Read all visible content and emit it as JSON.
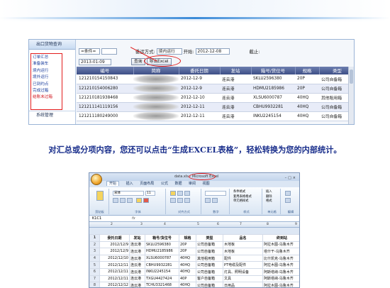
{
  "top_app": {
    "sidebar": {
      "header": "出口货物查询",
      "items": [
        "订单汇总",
        "准备装车",
        "境内运行",
        "境外运行",
        "已到约点",
        "完成过箱",
        "结账未过箱"
      ],
      "footer": "系统管理"
    },
    "filters": {
      "condition_select": "=条件=",
      "transport_label": "委运方式:",
      "transport_select": "境内运行",
      "start_label": "开始:",
      "start_value": "2012-12-08",
      "end_label": "截止:",
      "end_value": "2013-01-09",
      "query_button": "查询",
      "export_button": "导出Excel"
    },
    "table": {
      "columns": [
        "编号",
        "简称",
        "委托日期",
        "发站",
        "箱号/货位号",
        "规格",
        "类型"
      ],
      "rows": [
        [
          "121210154150843",
          "",
          "2012-12-9",
          "连云港",
          "SKLU2596380",
          "20P",
          "公司自备箱"
        ],
        [
          "121210154006280",
          "",
          "2012-12-9",
          "连云港",
          "HDMU2185986",
          "20P",
          "公司自备箱"
        ],
        [
          "121210181938468",
          "",
          "2012-12-10",
          "连云港",
          "XLSU6000787",
          "40HQ",
          "其他租用箱"
        ],
        [
          "121211141119156",
          "",
          "2012-12-11",
          "连云港",
          "CBHU9932281",
          "40HQ",
          "公司自备箱"
        ],
        [
          "121211180249000",
          "",
          "2012-12-11",
          "连云港",
          "INKU2245154",
          "40HQ",
          "公司自备箱"
        ]
      ]
    }
  },
  "caption": "对汇总或分项内容，您还可以点击“生成EXCEL表格”，轻松转换为您的内部统计。",
  "excel": {
    "title": "data.xls - Microsoft Excel",
    "tabs": [
      "开始",
      "插入",
      "页面布局",
      "公式",
      "数据",
      "审阅",
      "视图"
    ],
    "ribbon": {
      "font_name": "宋体",
      "font_size": "11",
      "groups": [
        "剪贴板",
        "字体",
        "对齐方式",
        "数字",
        "样式",
        "单元格",
        "编辑"
      ],
      "styles": [
        "条件格式",
        "套用表格格式",
        "单元格样式"
      ],
      "cells": [
        "插入",
        "删除",
        "格式"
      ]
    },
    "cell_ref": "K1C1",
    "col_numbers": [
      "1",
      "2",
      "3",
      "4",
      "5",
      "6",
      "7",
      "8",
      "9"
    ],
    "headers": [
      "委托日期",
      "发站",
      "箱号/货位号",
      "规格",
      "类型",
      "品名",
      "终到站"
    ],
    "rows": [
      [
        "2",
        "2012/12/9",
        "连云港",
        "SKLU2596380",
        "20P",
        "公司自备箱",
        "木地板",
        "阿拉木图-乌鲁木齐"
      ],
      [
        "3",
        "2012/12/9",
        "连云港",
        "HDMU2185986",
        "20P",
        "公司自备箱",
        "木地板",
        "塔什干-乌鲁木齐"
      ],
      [
        "4",
        "2012/12/10",
        "连云港",
        "XLSU6000787",
        "40HQ",
        "其他租用箱",
        "配件",
        "比什凯克-乌鲁木齐"
      ],
      [
        "5",
        "2012/12/11",
        "连云港",
        "CBHU9932281",
        "40HQ",
        "公司自备箱",
        "PT电缆及配件",
        "阿拉木图-乌鲁木齐"
      ],
      [
        "6",
        "2012/12/11",
        "连云港",
        "INKU2245154",
        "40HQ",
        "公司自备箱",
        "灯具、照明设备",
        "阿斯塔纳-乌鲁木齐"
      ],
      [
        "7",
        "2012/12/11",
        "连云港",
        "TXGU4427424",
        "40P",
        "客户自备箱",
        "文具",
        "阿斯塔纳-乌鲁木齐"
      ],
      [
        "8",
        "2012/12/12",
        "连云港",
        "TCHU3321468",
        "40HQ",
        "公司自备箱",
        "日用品",
        "阿拉木图-乌鲁木齐"
      ]
    ]
  }
}
